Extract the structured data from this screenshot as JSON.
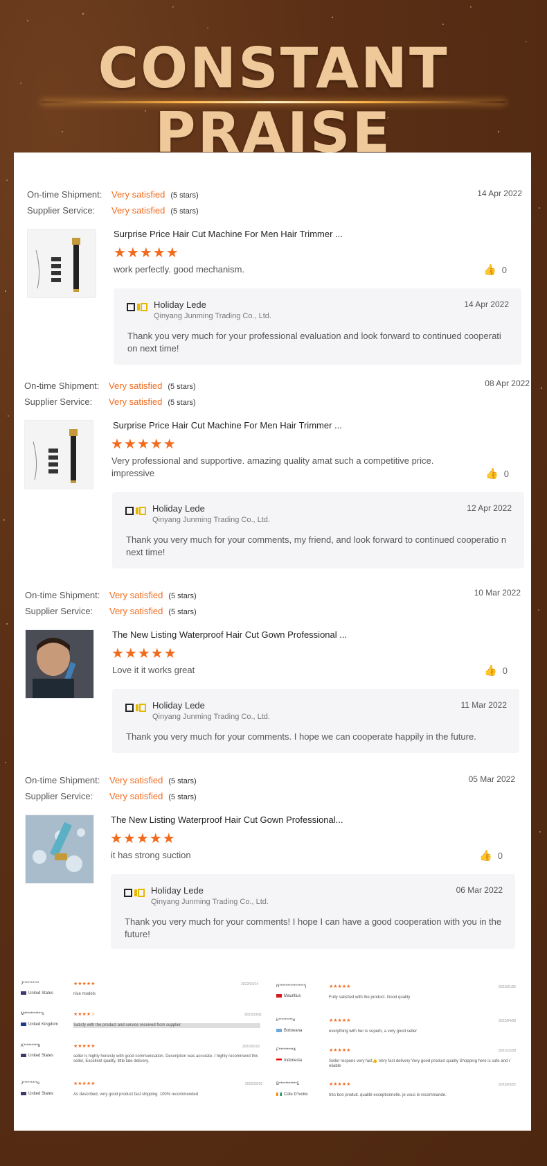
{
  "hero": {
    "title": "CONSTANT PRAISE"
  },
  "labels": {
    "shipment": "On-time Shipment:",
    "supplier": "Supplier Service:"
  },
  "reviews": [
    {
      "shipment_rating": "Very satisfied",
      "shipment_stars": "(5 stars)",
      "supplier_rating": "Very satisfied",
      "supplier_stars": "(5 stars)",
      "date": "14 Apr 2022",
      "product_title": "Surprise Price Hair Cut Machine For Men Hair Trimmer  ...",
      "stars": "★★★★★",
      "text": "work perfectly. good mechanism.",
      "likes": "0",
      "reply": {
        "name": "Holiday Lede",
        "company": "Qinyang Junming Trading Co., Ltd.",
        "date": "14 Apr 2022",
        "text": "Thank you very much for your professional evaluation and look forward to continued cooperati on next time!"
      }
    },
    {
      "shipment_rating": "Very satisfied",
      "shipment_stars": "(5 stars)",
      "supplier_rating": "Very satisfied",
      "supplier_stars": "(5 stars)",
      "date": "08 Apr 2022",
      "product_title": "Surprise Price Hair Cut Machine For Men Hair Trimmer ...",
      "stars": "★★★★★",
      "text": "Very professional and supportive. amazing quality amat such a competitive price. impressive",
      "likes": "0",
      "reply": {
        "name": "Holiday Lede",
        "company": "Qinyang Junming Trading Co., Ltd.",
        "date": "12 Apr 2022",
        "text": "Thank you very much for your comments, my friend, and look forward to continued cooperatio n next time!"
      }
    },
    {
      "shipment_rating": "Very satisfied",
      "shipment_stars": "(5 stars)",
      "supplier_rating": "Very satisfied",
      "supplier_stars": "(5 stars)",
      "date": "10 Mar 2022",
      "product_title": "The New Listing Waterproof Hair Cut Gown Professional ...",
      "stars": "★★★★★",
      "text": "Love it it works great",
      "likes": "0",
      "reply": {
        "name": "Holiday Lede",
        "company": "Qinyang Junming Trading Co., Ltd.",
        "date": "11 Mar 2022",
        "text": "Thank you very much for your comments. I hope we can cooperate happily in the future."
      }
    },
    {
      "shipment_rating": "Very satisfied",
      "shipment_stars": "(5 stars)",
      "supplier_rating": "Very satisfied",
      "supplier_stars": "(5 stars)",
      "date": "05 Mar 2022",
      "product_title": "The New Listing Waterproof Hair Cut Gown Professional...",
      "stars": "★★★★★",
      "text": "it has strong suction",
      "likes": "0",
      "reply": {
        "name": "Holiday Lede",
        "company": "Qinyang Junming Trading Co., Ltd.",
        "date": "06 Mar 2022",
        "text": "Thank you very much for your comments! I hope I can have a good cooperation with you in the future!"
      }
    }
  ],
  "mini_reviews_left": [
    {
      "user": "J**********",
      "country": "United States",
      "stars": "★★★★★",
      "date": "2022/03/14",
      "text": "nice models"
    },
    {
      "user": "M***********s",
      "country": "United Kingdom",
      "stars": "★★★★☆",
      "date": "2022/03/01",
      "text": "Satisfy with the product and service received from supplier"
    },
    {
      "user": "K*********b",
      "country": "United States",
      "stars": "★★★★★",
      "date": "2022/02/16",
      "text": "seller is highly honesty with good communication. Description was accurate. I highly recommend this seller, Excellent quality, little late delivery."
    },
    {
      "user": "J*********e",
      "country": "United States",
      "stars": "★★★★★",
      "date": "2022/02/16",
      "text": "As described, very good product fast shipping. 100% recommended"
    }
  ],
  "mini_reviews_right": [
    {
      "user": "N****************j",
      "country": "Mauritius",
      "stars": "★★★★★",
      "date": "2022/01/05",
      "text": "Fully satisfied with the product. Good quality"
    },
    {
      "user": "k*********e",
      "country": "Botswana",
      "stars": "★★★★★",
      "date": "2022/04/08",
      "text": "everything with her is superb, a very good seller"
    },
    {
      "user": "F*********4",
      "country": "Indonesia",
      "stars": "★★★★★",
      "date": "2021/12/28",
      "text": "Seller respons very fast👍 Very fast delivery Very good product quality Shopping here is safe and r eliable"
    },
    {
      "user": "B***********5",
      "country": "Cote D'Ivoire",
      "stars": "★★★★★",
      "date": "2022/03/22",
      "text": "très bon produit. qualité exceptionnelle. je vous le recommande."
    }
  ]
}
